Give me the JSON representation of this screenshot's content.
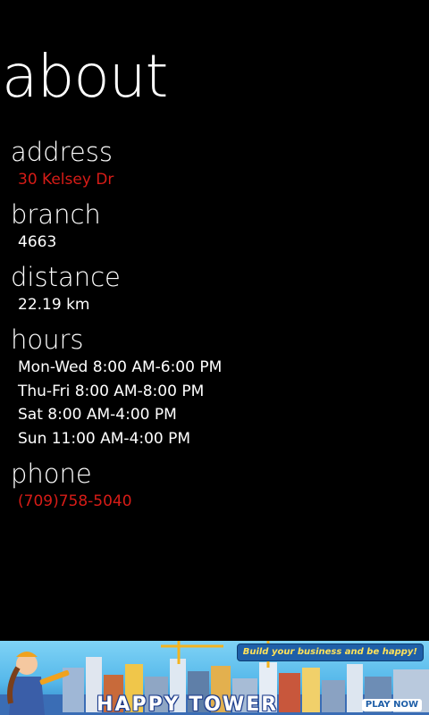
{
  "page": {
    "title": "about"
  },
  "address": {
    "label": "address",
    "value": "30 Kelsey Dr"
  },
  "branch": {
    "label": "branch",
    "value": "4663"
  },
  "distance": {
    "label": "distance",
    "value": "22.19 km"
  },
  "hours": {
    "label": "hours",
    "lines": [
      "Mon-Wed 8:00 AM-6:00 PM",
      "Thu-Fri 8:00 AM-8:00 PM",
      "Sat 8:00 AM-4:00 PM",
      "Sun 11:00 AM-4:00 PM"
    ]
  },
  "phone": {
    "label": "phone",
    "value": "(709)758-5040"
  },
  "ad": {
    "tagline": "Build your business and be happy!",
    "brand": "HAPPY TOWER",
    "cta": "PLAY NOW"
  },
  "colors": {
    "background": "#000000",
    "text": "#ffffff",
    "link": "#d71c17"
  }
}
